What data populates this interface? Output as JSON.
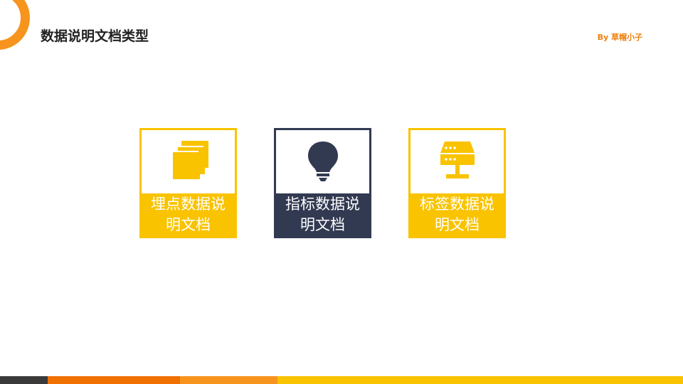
{
  "header": {
    "title": "数据说明文档类型",
    "byline": "By 草帽小子"
  },
  "cards": [
    {
      "label": "埋点数据说明文档",
      "icon": "stacked-layers-icon",
      "color": "#f9c300"
    },
    {
      "label": "指标数据说明文档",
      "icon": "lightbulb-icon",
      "color": "#323a52"
    },
    {
      "label": "标签数据说明文档",
      "icon": "server-network-icon",
      "color": "#f9c300"
    }
  ],
  "colors": {
    "accent_orange": "#f7941d",
    "accent_yellow": "#f9c300",
    "navy": "#323a52",
    "title_text": "#222222",
    "bottom_bar": [
      "#3a3a3a",
      "#f07000",
      "#f7941d",
      "#f9c300"
    ]
  }
}
